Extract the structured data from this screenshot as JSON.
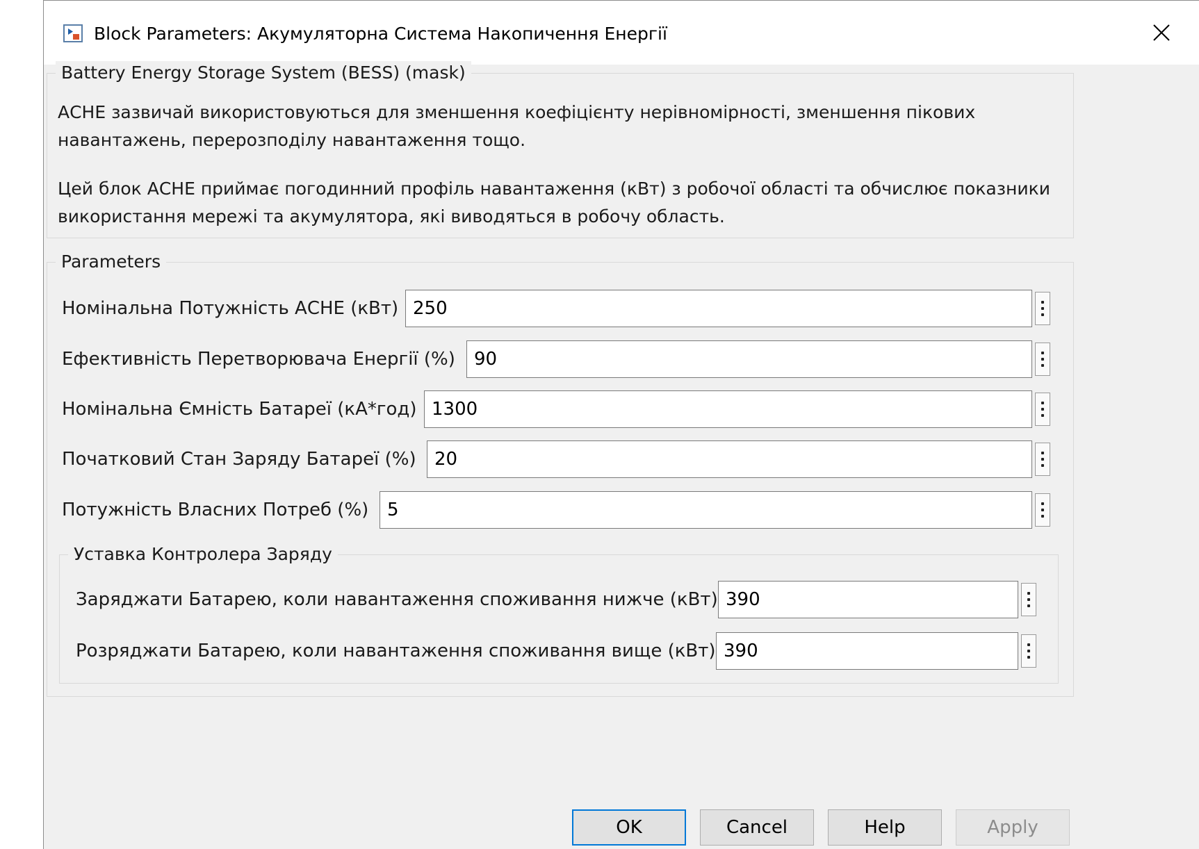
{
  "window": {
    "title": "Block Parameters: Акумуляторна Система Накопичення Енергії",
    "icon": "simulink-block-icon",
    "close_icon": "close-icon"
  },
  "description": {
    "group_title": "Battery Energy Storage System (BESS) (mask)",
    "paragraph1": "АСНЕ зазвичай використовуються для зменшення коефіцієнту нерівномірності, зменшення пікових навантажень, перерозподілу навантаження тощо.",
    "paragraph2": "Цей блок АСНЕ приймає погодинний профіль навантаження (кВт) з робочої області та обчислює показники використання мережі та акумулятора, які виводяться в робочу область."
  },
  "parameters": {
    "group_title": "Parameters",
    "fields": [
      {
        "label": "Номінальна Потужність АСНЕ (кВт)",
        "value": "250"
      },
      {
        "label": "Ефективність Перетворювача Енергії (%)",
        "value": "90"
      },
      {
        "label": "Номінальна Ємність Батареї (кА*год)",
        "value": "1300"
      },
      {
        "label": "Початковий Стан Заряду Батареї (%)",
        "value": "20"
      },
      {
        "label": "Потужність Власних Потреб (%)",
        "value": "5"
      }
    ],
    "subgroup": {
      "title": "Уставка Контролера Заряду",
      "fields": [
        {
          "label": "Заряджати Батарею, коли навантаження споживання нижче (кВт)",
          "value": "390"
        },
        {
          "label": "Розряджати Батарею, коли навантаження споживання вище (кВт)",
          "value": "390"
        }
      ]
    }
  },
  "buttons": {
    "ok": "OK",
    "cancel": "Cancel",
    "help": "Help",
    "apply": "Apply"
  },
  "colors": {
    "dialog_bg": "#f0f0f0",
    "default_button_border": "#0078d7"
  }
}
